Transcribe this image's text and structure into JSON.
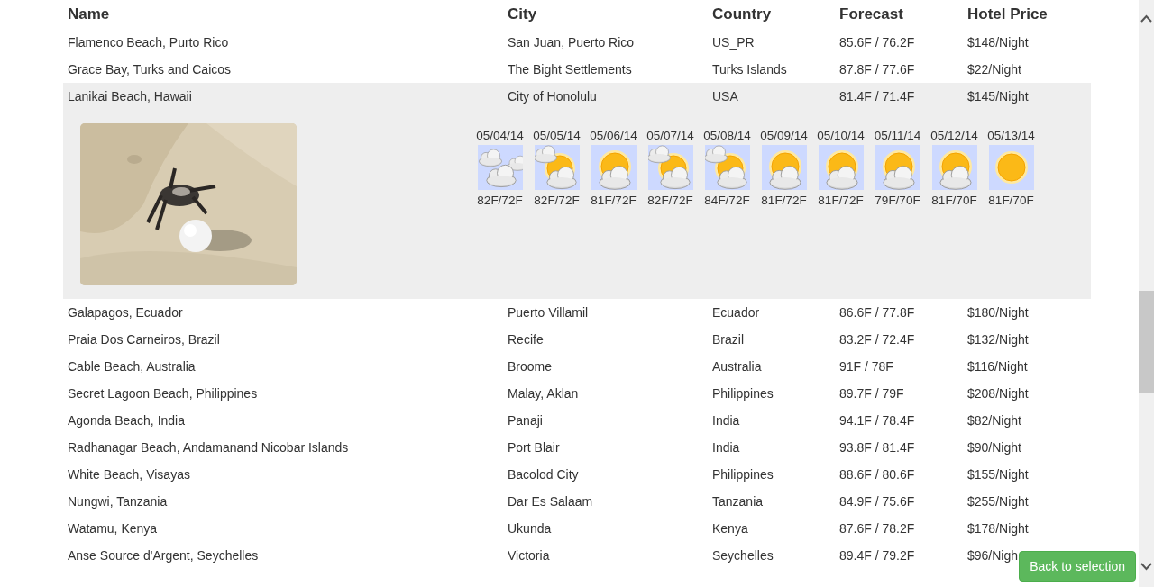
{
  "table": {
    "columns": [
      "Name",
      "City",
      "Country",
      "Forecast",
      "Hotel Price"
    ],
    "rows": [
      {
        "cells": [
          "Flamenco Beach, Purto Rico",
          "San Juan, Puerto Rico",
          "US_PR",
          "85.6F / 76.2F",
          "$148/Night"
        ],
        "expanded": false
      },
      {
        "cells": [
          "Grace Bay, Turks and Caicos",
          "The Bight Settlements",
          "Turks Islands",
          "87.8F / 77.6F",
          "$22/Night"
        ],
        "expanded": false
      },
      {
        "cells": [
          "Lanikai Beach, Hawaii",
          "City of Honolulu",
          "USA",
          "81.4F / 71.4F",
          "$145/Night"
        ],
        "expanded": true,
        "detail": {
          "forecast": [
            {
              "date": "05/04/14",
              "kind": "cloudy",
              "temps": "82F/72F"
            },
            {
              "date": "05/05/14",
              "kind": "partly",
              "temps": "82F/72F"
            },
            {
              "date": "05/06/14",
              "kind": "suncloud",
              "temps": "81F/72F"
            },
            {
              "date": "05/07/14",
              "kind": "partly",
              "temps": "82F/72F"
            },
            {
              "date": "05/08/14",
              "kind": "partly",
              "temps": "84F/72F"
            },
            {
              "date": "05/09/14",
              "kind": "suncloud",
              "temps": "81F/72F"
            },
            {
              "date": "05/10/14",
              "kind": "suncloud",
              "temps": "81F/72F"
            },
            {
              "date": "05/11/14",
              "kind": "suncloud",
              "temps": "79F/70F"
            },
            {
              "date": "05/12/14",
              "kind": "suncloud",
              "temps": "81F/70F"
            },
            {
              "date": "05/13/14",
              "kind": "sun",
              "temps": "81F/70F"
            }
          ]
        }
      },
      {
        "cells": [
          "Galapagos, Ecuador",
          "Puerto Villamil",
          "Ecuador",
          "86.6F / 77.8F",
          "$180/Night"
        ],
        "expanded": false
      },
      {
        "cells": [
          "Praia Dos Carneiros, Brazil",
          "Recife",
          "Brazil",
          "83.2F / 72.4F",
          "$132/Night"
        ],
        "expanded": false
      },
      {
        "cells": [
          "Cable Beach, Australia",
          "Broome",
          "Australia",
          "91F / 78F",
          "$116/Night"
        ],
        "expanded": false
      },
      {
        "cells": [
          "Secret Lagoon Beach, Philippines",
          "Malay, Aklan",
          "Philippines",
          "89.7F / 79F",
          "$208/Night"
        ],
        "expanded": false
      },
      {
        "cells": [
          "Agonda Beach, India",
          "Panaji",
          "India",
          "94.1F / 78.4F",
          "$82/Night"
        ],
        "expanded": false
      },
      {
        "cells": [
          "Radhanagar Beach, Andamanand Nicobar Islands",
          "Port Blair",
          "India",
          "93.8F / 81.4F",
          "$90/Night"
        ],
        "expanded": false
      },
      {
        "cells": [
          "White Beach, Visayas",
          "Bacolod City",
          "Philippines",
          "88.6F / 80.6F",
          "$155/Night"
        ],
        "expanded": false
      },
      {
        "cells": [
          "Nungwi, Tanzania",
          "Dar Es Salaam",
          "Tanzania",
          "84.9F / 75.6F",
          "$255/Night"
        ],
        "expanded": false
      },
      {
        "cells": [
          "Watamu, Kenya",
          "Ukunda",
          "Kenya",
          "87.6F / 78.2F",
          "$178/Night"
        ],
        "expanded": false
      },
      {
        "cells": [
          "Anse Source d'Argent, Seychelles",
          "Victoria",
          "Seychelles",
          "89.4F / 79.2F",
          "$96/Nigh"
        ],
        "expanded": false
      }
    ]
  },
  "back_button": {
    "label": "Back to selection"
  }
}
